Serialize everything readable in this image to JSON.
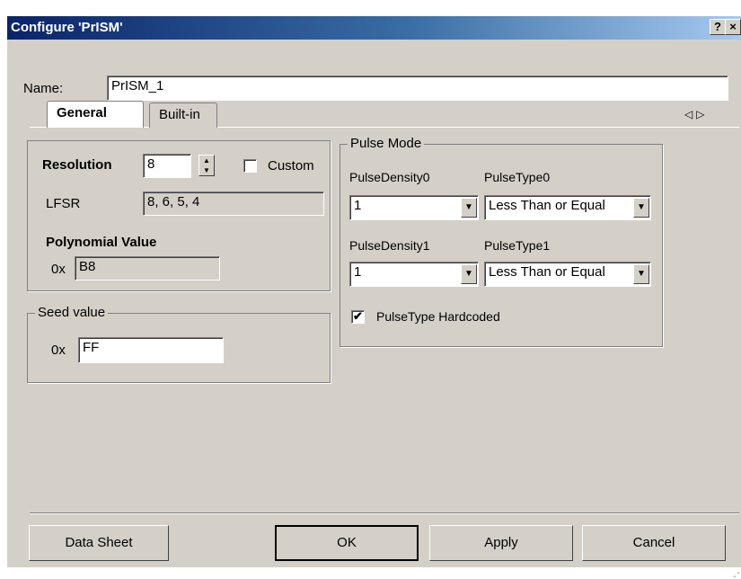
{
  "window": {
    "title": "Configure 'PrISM'",
    "help_label": "?",
    "close_label": "×"
  },
  "name_field": {
    "label": "Name:",
    "value": "PrISM_1"
  },
  "tabs": [
    {
      "label": "General"
    },
    {
      "label": "Built-in"
    }
  ],
  "tab_nav": {
    "prev": "◁",
    "next": "▷"
  },
  "resolution": {
    "label": "Resolution",
    "value": "8",
    "custom_label": "Custom",
    "custom_checked": false
  },
  "lfsr": {
    "label": "LFSR",
    "value": "8, 6, 5, 4"
  },
  "polynomial": {
    "label": "Polynomial Value",
    "prefix": "0x",
    "value": "B8"
  },
  "seed": {
    "legend": "Seed value",
    "prefix": "0x",
    "value": "FF"
  },
  "pulse_mode": {
    "legend": "Pulse Mode",
    "density0_label": "PulseDensity0",
    "density0_value": "1",
    "type0_label": "PulseType0",
    "type0_value": "Less Than or Equal",
    "density1_label": "PulseDensity1",
    "density1_value": "1",
    "type1_label": "PulseType1",
    "type1_value": "Less Than or Equal",
    "hardcoded_label": "PulseType Hardcoded",
    "hardcoded_checked": true
  },
  "buttons": {
    "datasheet": "Data Sheet",
    "ok": "OK",
    "apply": "Apply",
    "cancel": "Cancel"
  },
  "icons": {
    "check": "✔",
    "dropdown": "▼",
    "spin_up": "▲",
    "spin_down": "▼",
    "grip": "⋰"
  },
  "colors": {
    "titlebar_start": "#0a246a",
    "titlebar_end": "#a6caf0",
    "dialog_bg": "#d4d0c8"
  }
}
